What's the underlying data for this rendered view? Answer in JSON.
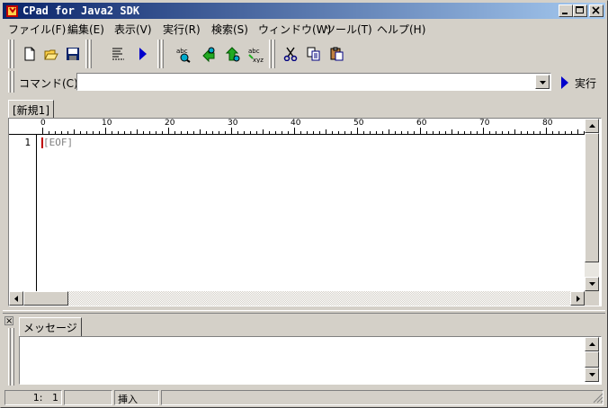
{
  "window": {
    "title": "CPad for Java2 SDK"
  },
  "menu": {
    "items": [
      {
        "label": "ファイル(F)"
      },
      {
        "label": "編集(E)"
      },
      {
        "label": "表示(V)"
      },
      {
        "label": "実行(R)"
      },
      {
        "label": "検索(S)"
      },
      {
        "label": "ウィンドウ(W)"
      },
      {
        "label": "ツール(T)"
      },
      {
        "label": "ヘルプ(H)"
      }
    ]
  },
  "command_bar": {
    "label": "コマンド(C)",
    "value": "",
    "run_label": "実行"
  },
  "document_tab": {
    "label": "[新規1]"
  },
  "editor": {
    "ruler": [
      "0",
      "10",
      "20",
      "30",
      "40",
      "50",
      "60",
      "70",
      "80"
    ],
    "lines": [
      {
        "number": "1",
        "text": "[EOF]"
      }
    ]
  },
  "message_panel": {
    "tab_label": "メッセージ",
    "close_label": "×"
  },
  "status": {
    "line": "1",
    "col": "1",
    "mode": "挿入"
  },
  "colors": {
    "title_start": "#0a246a",
    "title_end": "#a6caf0",
    "caret": "#c00000"
  }
}
